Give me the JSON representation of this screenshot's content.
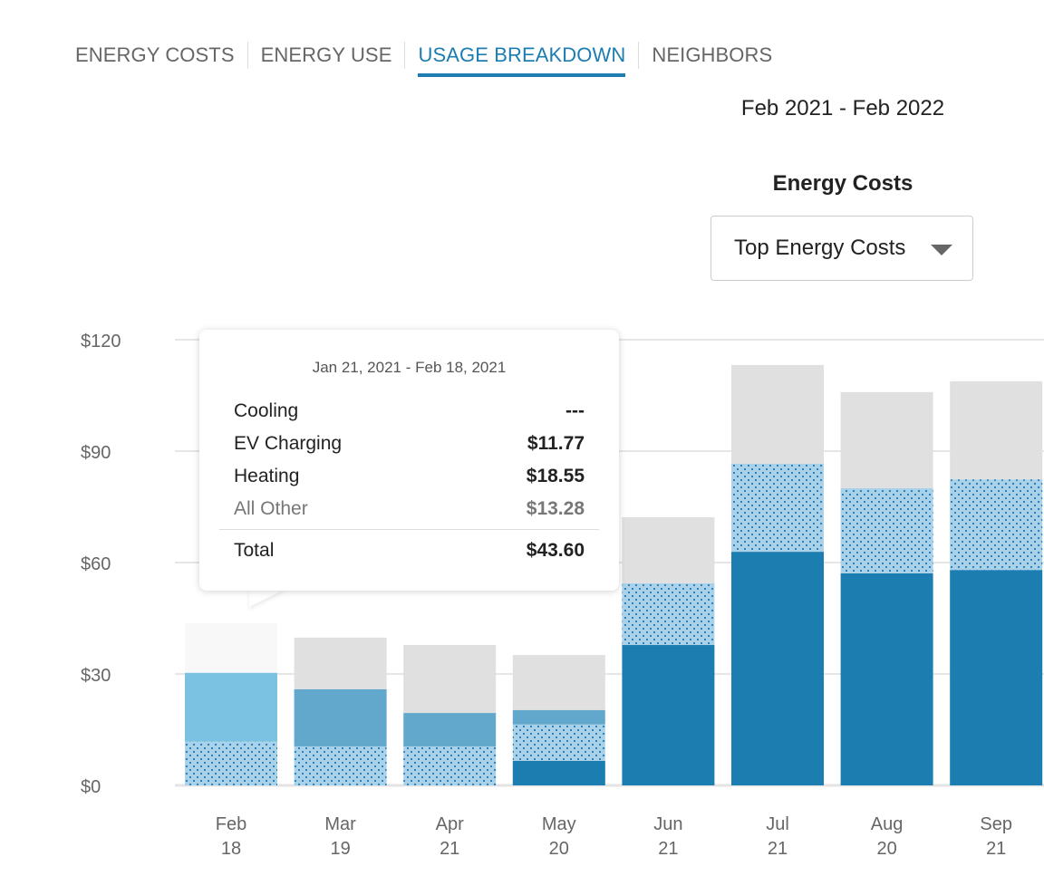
{
  "tabs": [
    {
      "label": "ENERGY COSTS",
      "active": false
    },
    {
      "label": "ENERGY USE",
      "active": false
    },
    {
      "label": "USAGE BREAKDOWN",
      "active": true
    },
    {
      "label": "NEIGHBORS",
      "active": false
    }
  ],
  "date_range": "Feb 2021 - Feb 2022",
  "chart_title": "Energy Costs",
  "dropdown": {
    "selected": "Top Energy Costs",
    "icon": "caret-down-icon"
  },
  "tooltip": {
    "date_range": "Jan 21, 2021 - Feb 18, 2021",
    "rows": [
      {
        "label": "Cooling",
        "value": "---"
      },
      {
        "label": "EV Charging",
        "value": "$11.77"
      },
      {
        "label": "Heating",
        "value": "$18.55"
      },
      {
        "label": "All Other",
        "value": "$13.28"
      }
    ],
    "total_label": "Total",
    "total_value": "$43.60"
  },
  "colors": {
    "cooling": "#1c7db1",
    "ev_charging_bg": "#a9d1e7",
    "ev_charging_dot": "#2a80c0",
    "heating": "#62a8cc",
    "heating_highlight": "#7bc1e1",
    "all_other": "#e0e0e0",
    "all_other_highlight": "#f8f8f8",
    "active_tab": "#1d7db1"
  },
  "chart_data": {
    "type": "bar",
    "stacked": true,
    "title": "Energy Costs",
    "xlabel": "",
    "ylabel": "",
    "ylim": [
      0,
      120
    ],
    "yticks": [
      0,
      30,
      60,
      90,
      120
    ],
    "ytick_labels": [
      "$0",
      "$30",
      "$60",
      "$90",
      "$120"
    ],
    "grid": true,
    "categories": [
      {
        "month": "Feb",
        "day": "18"
      },
      {
        "month": "Mar",
        "day": "19"
      },
      {
        "month": "Apr",
        "day": "21"
      },
      {
        "month": "May",
        "day": "20"
      },
      {
        "month": "Jun",
        "day": "21"
      },
      {
        "month": "Jul",
        "day": "21"
      },
      {
        "month": "Aug",
        "day": "20"
      },
      {
        "month": "Sep",
        "day": "21"
      }
    ],
    "highlighted_index": 0,
    "series": [
      {
        "name": "Cooling",
        "key": "cooling",
        "values": [
          0,
          0,
          0,
          6.6,
          37.8,
          62.9,
          57.1,
          58.0
        ]
      },
      {
        "name": "EV Charging",
        "key": "ev_charging",
        "values": [
          11.77,
          10.5,
          10.5,
          9.8,
          16.6,
          23.7,
          22.9,
          24.4
        ]
      },
      {
        "name": "Heating",
        "key": "heating",
        "values": [
          18.55,
          15.4,
          9.0,
          3.9,
          0,
          0,
          0,
          0
        ]
      },
      {
        "name": "All Other",
        "key": "all_other",
        "values": [
          13.28,
          13.9,
          18.3,
          14.8,
          17.8,
          26.6,
          25.9,
          26.4
        ]
      }
    ]
  }
}
